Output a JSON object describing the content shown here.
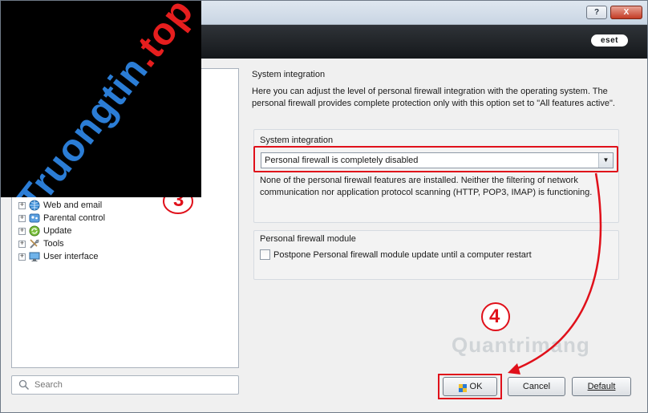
{
  "titlebar": {
    "help_label": "?",
    "close_label": "X"
  },
  "header": {
    "logo_text": "eset"
  },
  "tree": {
    "items": [
      {
        "label": "Web and email",
        "icon": "globe-icon"
      },
      {
        "label": "Parental control",
        "icon": "parental-icon"
      },
      {
        "label": "Update",
        "icon": "update-icon"
      },
      {
        "label": "Tools",
        "icon": "tools-icon"
      },
      {
        "label": "User interface",
        "icon": "monitor-icon"
      }
    ],
    "partial_text": "n"
  },
  "search": {
    "placeholder": "Search"
  },
  "main": {
    "title": "System integration",
    "description": "Here you can adjust the level of personal firewall integration with the operating system. The personal firewall provides complete protection only with this option set to \"All features active\".",
    "integration_group": {
      "title": "System integration",
      "selected_value": "Personal firewall is completely disabled",
      "detail": "None of the personal firewall features are installed. Neither the filtering of network communication nor application protocol scanning (HTTP, POP3, IMAP) is functioning."
    },
    "module_group": {
      "title": "Personal firewall module",
      "checkbox_label": "Postpone Personal firewall module update until a computer restart",
      "checkbox_checked": false
    }
  },
  "buttons": {
    "ok": "OK",
    "cancel": "Cancel",
    "default": "Default"
  },
  "annotations": {
    "step3": "3",
    "step4": "4",
    "color": "#e0101a"
  },
  "overlay": {
    "brand_main": "Truongtin",
    "brand_suffix": ".top"
  },
  "watermark": {
    "text": "Quantrimang"
  }
}
